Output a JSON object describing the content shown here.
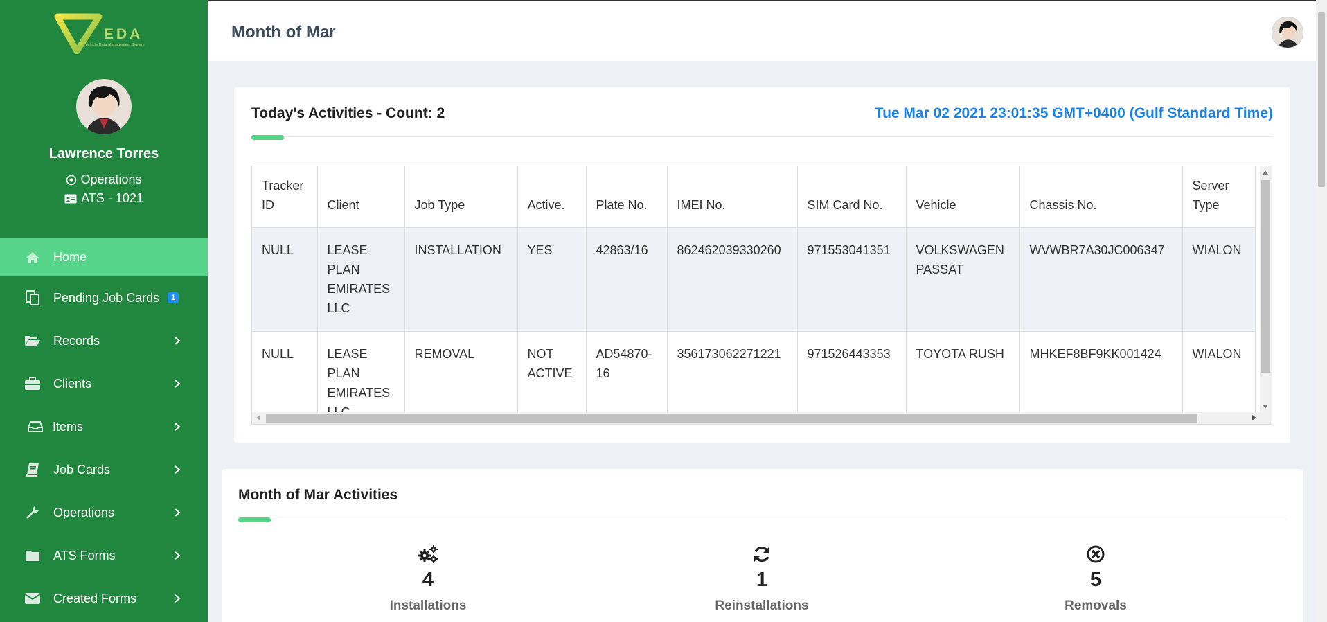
{
  "brand": {
    "logo_text": "EDA",
    "logo_tagline": "Vehicle Data Management System"
  },
  "user": {
    "name": "Lawrence Torres",
    "role": "Operations",
    "id_label": "ATS - 1021"
  },
  "nav": [
    {
      "label": "Home",
      "icon": "home-icon",
      "active": true
    },
    {
      "label": "Pending Job Cards",
      "icon": "copy-icon",
      "badge": "1"
    },
    {
      "label": "Records",
      "icon": "folder-open-icon",
      "chevron": true
    },
    {
      "label": "Clients",
      "icon": "briefcase-icon",
      "chevron": true
    },
    {
      "label": "Items",
      "icon": "inbox-icon",
      "chevron": true
    },
    {
      "label": "Job Cards",
      "icon": "book-icon",
      "chevron": true
    },
    {
      "label": "Operations",
      "icon": "wrench-icon",
      "chevron": true
    },
    {
      "label": "ATS Forms",
      "icon": "folder-icon",
      "chevron": true
    },
    {
      "label": "Created Forms",
      "icon": "envelope-icon",
      "chevron": true
    }
  ],
  "header": {
    "title": "Month of Mar"
  },
  "today": {
    "title": "Today's Activities - Count: 2",
    "datetime": "Tue Mar 02 2021 23:01:35 GMT+0400 (Gulf Standard Time)",
    "columns": [
      "Tracker ID",
      "Client",
      "Job Type",
      "Active.",
      "Plate No.",
      "IMEI No.",
      "SIM Card No.",
      "Vehicle",
      "Chassis No.",
      "Server Type"
    ],
    "rows": [
      [
        "NULL",
        "LEASE PLAN EMIRATES LLC",
        "INSTALLATION",
        "YES",
        "42863/16",
        "862462039330260",
        "971553041351",
        "VOLKSWAGEN PASSAT",
        "WVWBR7A30JC006347",
        "WIALON"
      ],
      [
        "NULL",
        "LEASE PLAN EMIRATES LLC",
        "REMOVAL",
        "NOT ACTIVE",
        "AD54870-16",
        "356173062271221",
        "971526443353",
        "TOYOTA RUSH",
        "MHKEF8BF9KK001424",
        "WIALON"
      ]
    ]
  },
  "month": {
    "title": "Month of Mar Activities",
    "stats": [
      {
        "value": "4",
        "label": "Installations",
        "icon": "cogs-icon"
      },
      {
        "value": "1",
        "label": "Reinstallations",
        "icon": "sync-icon"
      },
      {
        "value": "5",
        "label": "Removals",
        "icon": "times-circle-icon"
      }
    ]
  },
  "colors": {
    "sidebar": "#21873f",
    "active": "#56d48a",
    "accent_blue": "#1a82e6"
  }
}
